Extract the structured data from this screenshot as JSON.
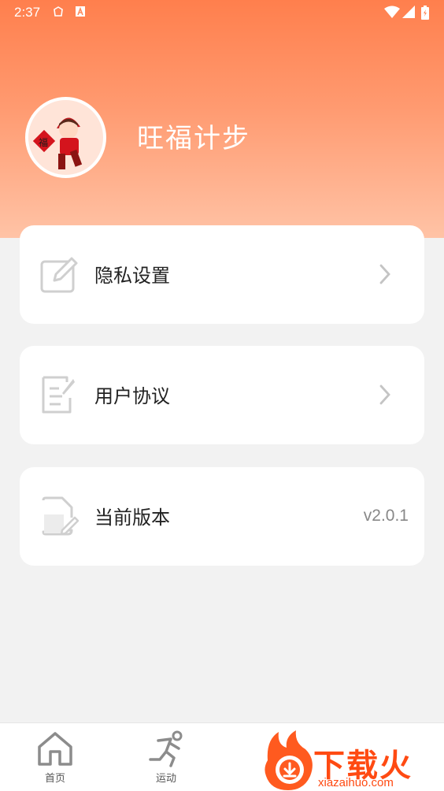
{
  "status_bar": {
    "time": "2:37"
  },
  "profile": {
    "app_name": "旺福计步",
    "avatar_badge": "福"
  },
  "menu": [
    {
      "label": "隐私设置",
      "icon": "edit-icon"
    },
    {
      "label": "用户协议",
      "icon": "document-icon"
    },
    {
      "label": "当前版本",
      "icon": "file-icon",
      "value": "v2.0.1"
    }
  ],
  "tabbar": {
    "tabs": [
      {
        "label": "首页",
        "icon": "home-icon"
      },
      {
        "label": "运动",
        "icon": "running-icon"
      }
    ]
  },
  "watermark": {
    "brand": "下载火",
    "url": "xiazaihuo.com"
  },
  "colors": {
    "header_top": "#ff7f4d",
    "header_bottom": "#ffc3a6",
    "background": "#f2f2f2"
  }
}
